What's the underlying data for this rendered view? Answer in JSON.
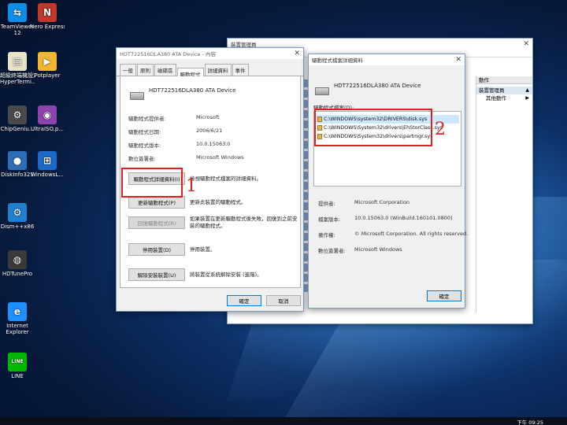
{
  "desktop": {
    "icons": [
      {
        "name": "teamviewer",
        "label_lines": [
          "TeamViewer",
          "12"
        ],
        "color": "#0e8ee9",
        "glyph": "⇆"
      },
      {
        "name": "nero-express",
        "label_lines": [
          "Nero Express"
        ],
        "color": "#c0392b",
        "glyph": "N"
      },
      {
        "name": "hyperterminal",
        "label_lines": [
          "超級終端機設定",
          "HyperTermi..."
        ],
        "color": "#e9e3c8",
        "glyph": "▤"
      },
      {
        "name": "potplayer",
        "label_lines": [
          "Potplayer"
        ],
        "color": "#f2b632",
        "glyph": "▶"
      },
      {
        "name": "chipgenius",
        "label_lines": [
          "ChipGeniu..."
        ],
        "color": "#4a4a4a",
        "glyph": "⚙"
      },
      {
        "name": "ultraiso",
        "label_lines": [
          "UltraISO.p..."
        ],
        "color": "#8e44ad",
        "glyph": "◉"
      },
      {
        "name": "diskinfo",
        "label_lines": [
          "DiskInfo32S"
        ],
        "color": "#2d6fb7",
        "glyph": "●"
      },
      {
        "name": "windows",
        "label_lines": [
          "WindowsL..."
        ],
        "color": "#1b6ac9",
        "glyph": "⊞"
      },
      {
        "name": "dism",
        "label_lines": [
          "Dism++x86"
        ],
        "color": "#1f80d0",
        "glyph": "⚙"
      },
      {
        "name": "hdtunepro",
        "label_lines": [
          "HDTunePro"
        ],
        "color": "#3a3a3a",
        "glyph": "◍"
      },
      {
        "name": "internet-explorer",
        "label_lines": [
          "Internet",
          "Explorer"
        ],
        "color": "#1e90ff",
        "glyph": "e"
      },
      {
        "name": "line",
        "label_lines": [
          "LINE"
        ],
        "color": "#00b900",
        "glyph": "LINE"
      }
    ]
  },
  "device_manager": {
    "title": "裝置管理員",
    "panel_header": "動作",
    "panel_sub": "裝置管理員",
    "panel_item": "其他動作"
  },
  "properties": {
    "title": "HDT722516DLA380 ATA Device - 內容",
    "tabs": [
      "一般",
      "原則",
      "磁碟區",
      "驅動程式",
      "詳細資料",
      "事件"
    ],
    "active_tab": "驅動程式",
    "device_name": "HDT722516DLA380 ATA Device",
    "rows": [
      {
        "label": "驅動程式提供者:",
        "value": "Microsoft"
      },
      {
        "label": "驅動程式日期:",
        "value": "2006/6/21"
      },
      {
        "label": "驅動程式版本:",
        "value": "10.0.15063.0"
      },
      {
        "label": "數位簽署者:",
        "value": "Microsoft Windows"
      }
    ],
    "buttons": [
      {
        "label": "驅動程式詳細資料(I)",
        "desc": "檢視驅動程式檔案的詳細資料。",
        "disabled": false
      },
      {
        "label": "更新驅動程式(P)",
        "desc": "更新此裝置的驅動程式。",
        "disabled": false
      },
      {
        "label": "回復驅動程式(R)",
        "desc": "如果裝置在更新驅動程式後失敗，回復到之前安裝的驅動程式。",
        "disabled": true
      },
      {
        "label": "停用裝置(D)",
        "desc": "停用裝置。",
        "disabled": false
      },
      {
        "label": "解除安裝裝置(U)",
        "desc": "將裝置從系統解除安裝 (進階)。",
        "disabled": false
      }
    ],
    "ok_label": "確定",
    "cancel_label": "取消"
  },
  "driver_files": {
    "title": "驅動程式檔案詳細資料",
    "device_name": "HDT722516DLA380 ATA Device",
    "files_label": "驅動程式檔案(D):",
    "files": [
      "C:\\WINDOWS\\system32\\DRIVERS\\disk.sys",
      "C:\\WINDOWS\\System32\\drivers\\EhStorClass.sys",
      "C:\\WINDOWS\\System32\\drivers\\partmgr.sys"
    ],
    "meta": [
      {
        "label": "提供者:",
        "value": "Microsoft Corporation"
      },
      {
        "label": "檔案版本:",
        "value": "10.0.15063.0 (WinBuild.160101.0800)"
      },
      {
        "label": "著作權:",
        "value": "© Microsoft Corporation. All rights reserved."
      },
      {
        "label": "數位簽署者:",
        "value": "Microsoft Windows"
      }
    ],
    "ok_label": "確定"
  },
  "annotations": {
    "one": "1",
    "two": "2",
    "color": "#e02020"
  },
  "taskbar": {
    "clock": "下午 09:25"
  }
}
